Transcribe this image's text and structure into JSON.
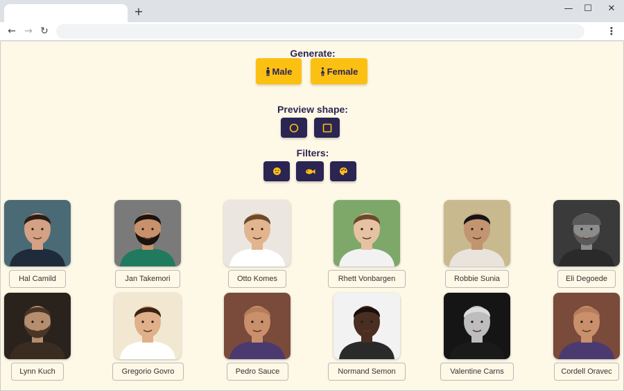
{
  "browser": {
    "new_tab_symbol": "+",
    "window_controls": {
      "minimize": "—",
      "maximize": "☐",
      "close": "✕"
    },
    "nav": {
      "back": "←",
      "forward": "→",
      "reload": "↻",
      "menu": "⋮"
    }
  },
  "generate": {
    "heading": "Generate:",
    "male_label": "Male",
    "female_label": "Female",
    "button_color": "#fbc012"
  },
  "preview_shape": {
    "heading": "Preview shape:",
    "options": [
      "circle",
      "square"
    ]
  },
  "filters": {
    "heading": "Filters:",
    "options": [
      "emoji-face-icon",
      "fish-icon",
      "palette-icon"
    ]
  },
  "colors": {
    "page_background": "#fef8e7",
    "dark": "#2b2553",
    "accent": "#fbc012"
  },
  "people": [
    {
      "name": "Hal Camild",
      "bg": "#4a6a76",
      "skin": "#d4a184",
      "hair": "#2a1d14",
      "shirt": "#1f2b3a",
      "beard": false,
      "hat": false
    },
    {
      "name": "Jan Takemori",
      "bg": "#7a7a7a",
      "skin": "#c8916b",
      "hair": "#1a1410",
      "shirt": "#1f7a5e",
      "beard": true,
      "hat": false
    },
    {
      "name": "Otto Komes",
      "bg": "#ebe6e0",
      "skin": "#e2b58f",
      "hair": "#6b4a2c",
      "shirt": "#ffffff",
      "beard": false,
      "hat": false
    },
    {
      "name": "Rhett Vonbargen",
      "bg": "#7ea86a",
      "skin": "#e6c2a3",
      "hair": "#6a4a2e",
      "shirt": "#f2f2f2",
      "beard": false,
      "hat": false
    },
    {
      "name": "Robbie Sunia",
      "bg": "#c8b98f",
      "skin": "#c29470",
      "hair": "#151515",
      "shirt": "#e8e4dc",
      "beard": false,
      "hat": false
    },
    {
      "name": "Eli Degoede",
      "bg": "#3a3a3a",
      "skin": "#8c8c8c",
      "hair": "#5a5a5a",
      "shirt": "#2a2a2a",
      "beard": true,
      "hat": true
    },
    {
      "name": "Lynn Kuch",
      "bg": "#2a221c",
      "skin": "#b58e6f",
      "hair": "#4a3626",
      "shirt": "#3a2c20",
      "beard": true,
      "hat": false
    },
    {
      "name": "Gregorio Govro",
      "bg": "#f2e8d2",
      "skin": "#e0b08a",
      "hair": "#3a2414",
      "shirt": "#ffffff",
      "beard": false,
      "hat": false
    },
    {
      "name": "Pedro Sauce",
      "bg": "#7a4a3a",
      "skin": "#c9906b",
      "hair": "#b57d5c",
      "shirt": "#4a3a70",
      "beard": false,
      "hat": false
    },
    {
      "name": "Normand Semon",
      "bg": "#f2f2f2",
      "skin": "#4a2e22",
      "hair": "#1a100c",
      "shirt": "#2a2a2a",
      "beard": false,
      "hat": false
    },
    {
      "name": "Valentine Carns",
      "bg": "#151515",
      "skin": "#bdbdbd",
      "hair": "#dcdcdc",
      "shirt": "#1a1a1a",
      "beard": false,
      "hat": false
    },
    {
      "name": "Cordell Oravec",
      "bg": "#7a4a3a",
      "skin": "#c9906b",
      "hair": "#b57d5c",
      "shirt": "#4a3a70",
      "beard": false,
      "hat": false
    }
  ]
}
